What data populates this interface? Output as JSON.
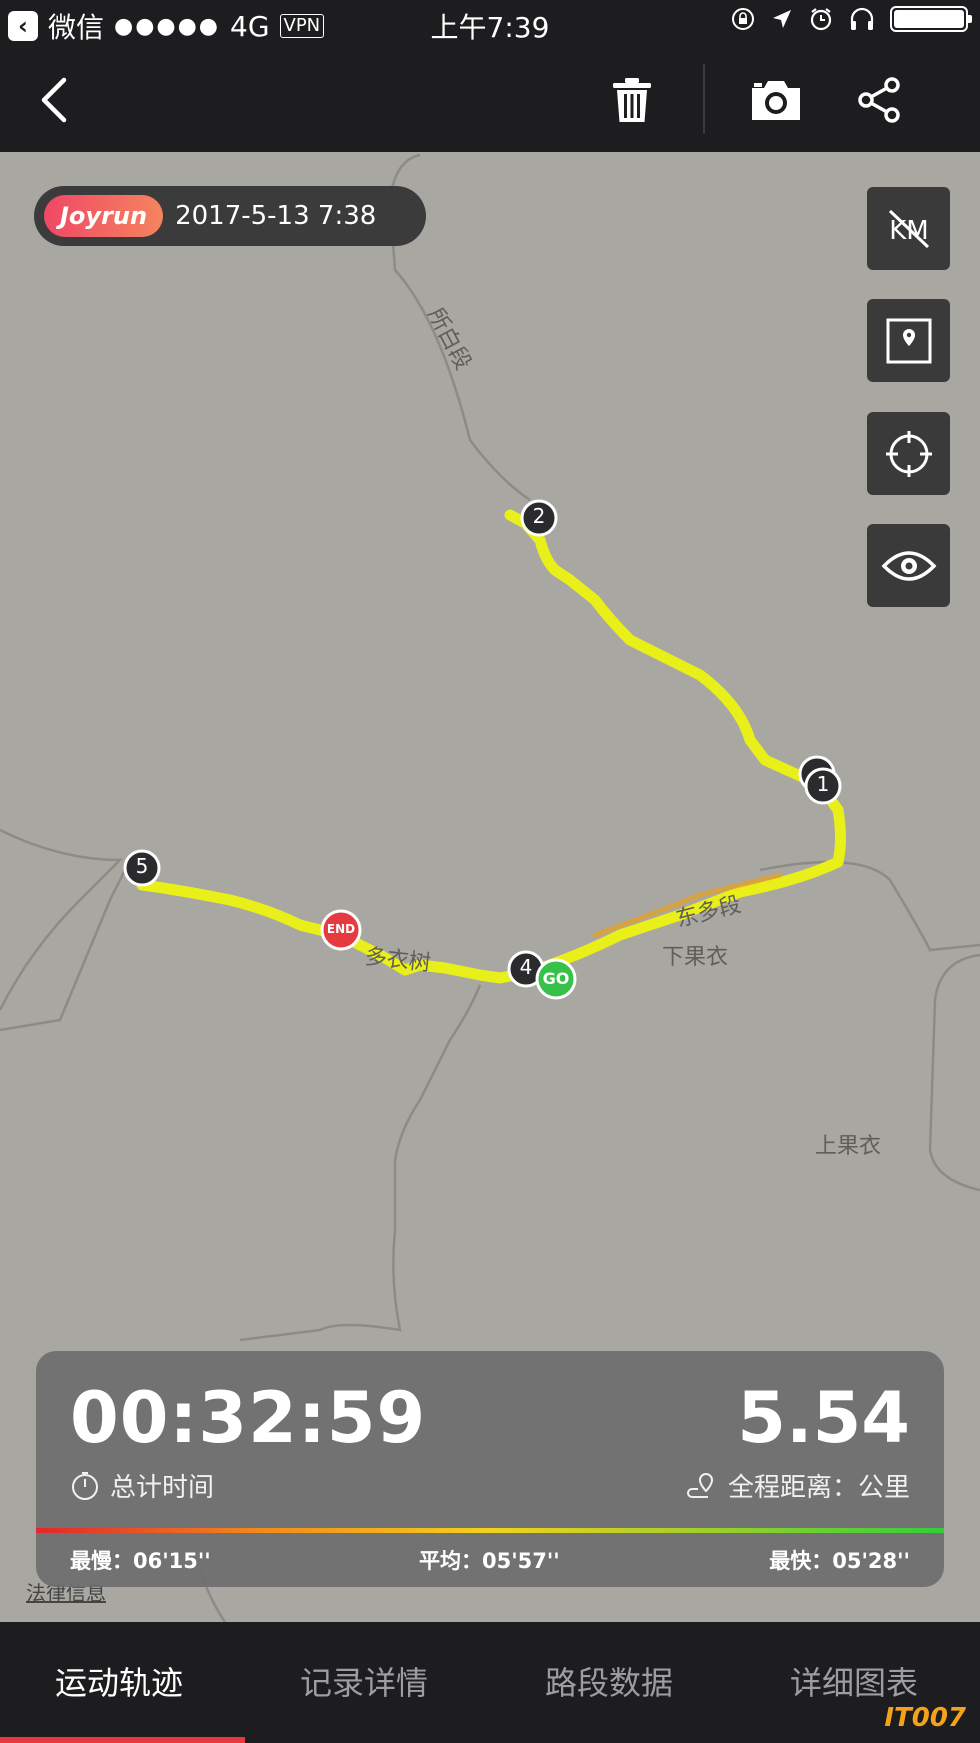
{
  "status_bar": {
    "back_app": "微信",
    "signal": "●●●●●",
    "network": "4G",
    "vpn": "VPN",
    "time": "上午7:39"
  },
  "toolbar": {
    "back_icon": "chevron-left-icon",
    "delete_icon": "trash-icon",
    "camera_icon": "camera-icon",
    "share_icon": "share-icon"
  },
  "map": {
    "brand": "Joyrun",
    "datetime": "2017-5-13 7:38",
    "places": [
      "所白段",
      "下果衣",
      "上果衣",
      "多衣树",
      "东多段"
    ],
    "markers": {
      "start": "GO",
      "end": "END",
      "km": [
        "1",
        "2",
        "4",
        "5"
      ]
    },
    "side_buttons": [
      "km-toggle-icon",
      "map-style-icon",
      "locate-icon",
      "eye-icon"
    ],
    "route_color": "#e9ef18"
  },
  "stats": {
    "duration": "00:32:59",
    "duration_label": "总计时间",
    "distance": "5.54",
    "distance_label": "全程距离：公里",
    "slowest": "最慢：06'15''",
    "average": "平均：05'57''",
    "fastest": "最快：05'28''"
  },
  "legal": "法律信息",
  "tabs": [
    "运动轨迹",
    "记录详情",
    "路段数据",
    "详细图表"
  ],
  "watermark": "IT007"
}
